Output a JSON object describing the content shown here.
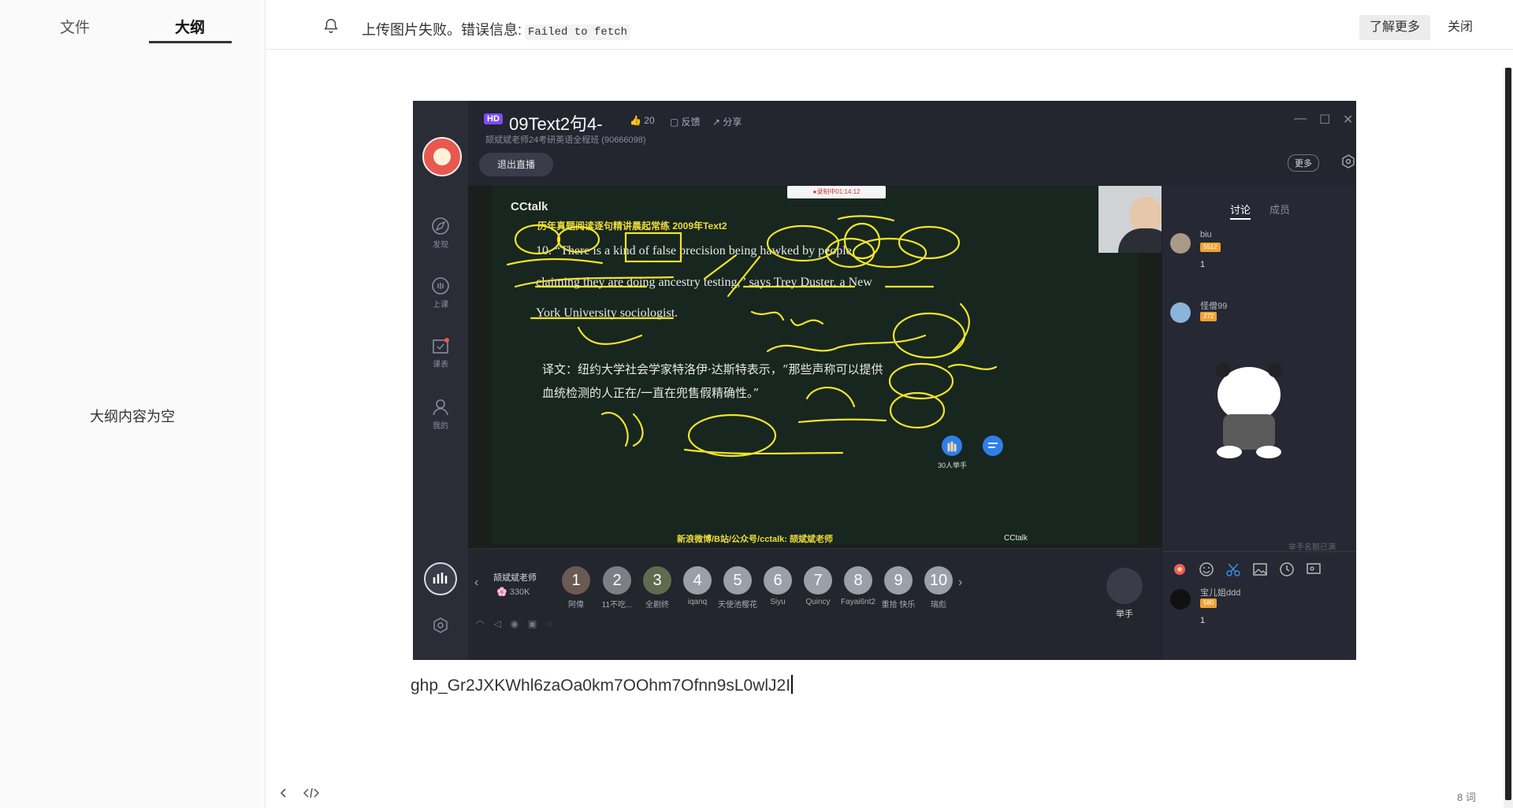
{
  "sidebar": {
    "tabs": [
      {
        "label": "文件"
      },
      {
        "label": "大纲"
      }
    ],
    "empty_message": "大纲内容为空"
  },
  "notice": {
    "message": "上传图片失败。错误信息:",
    "error_code": "Failed to fetch",
    "learn_more": "了解更多",
    "close": "关闭"
  },
  "embedded_screenshot": {
    "app": "CCtalk",
    "title": "09Text2句4-",
    "hd": "HD",
    "likes": "20",
    "feedback": "反馈",
    "share": "分享",
    "subtitle": "颉斌斌老师24考研英语全程班 (90666098)",
    "exit_live": "退出直播",
    "more": "更多",
    "rail": [
      "发现",
      "上课",
      "课表",
      "我的"
    ],
    "recording": "●录制中01:14:12",
    "board": {
      "heading": "历年真题阅读逐句精讲晨起常练 2009年Text2",
      "line1": "10. “There is a kind of false precision being hawked by people",
      "line2": "claiming they are doing ancestry testing,” says Trey Duster, a New",
      "line3": "York University sociologist.",
      "trans1": "译文：纽约大学社会学家特洛伊·达斯特表示，“那些声称可以提供",
      "trans2": "血统检测的人正在/一直在兜售假精确性。”",
      "footer": "新浪微博/B站/公众号/cctalk: 颉斌斌老师",
      "raise_count": "30人举手"
    },
    "chat": {
      "tabs": [
        "讨论",
        "成员"
      ],
      "messages": [
        {
          "name": "biu",
          "level": "5512",
          "text": "1"
        },
        {
          "name": "怪僧99",
          "level": "272",
          "text": ""
        },
        {
          "name": "宝儿姐ddd",
          "level": "580",
          "text": "1"
        }
      ],
      "raise_full": "举手名额已满"
    },
    "teacher": {
      "name": "颉斌斌老师",
      "fans": "330K"
    },
    "seats": [
      {
        "num": "1",
        "name": "阿偉"
      },
      {
        "num": "2",
        "name": "11不吃..."
      },
      {
        "num": "3",
        "name": "全剧终"
      },
      {
        "num": "4",
        "name": "iqanq"
      },
      {
        "num": "5",
        "name": "天使池樱花"
      },
      {
        "num": "6",
        "name": "Siyu"
      },
      {
        "num": "7",
        "name": "Quincy"
      },
      {
        "num": "8",
        "name": "Fayai6nt2"
      },
      {
        "num": "9",
        "name": "重拾 快乐"
      },
      {
        "num": "10",
        "name": "瑞彪"
      }
    ],
    "raise_hand": "举手"
  },
  "editor": {
    "token_text": "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",
    "word_count": "8 词"
  }
}
